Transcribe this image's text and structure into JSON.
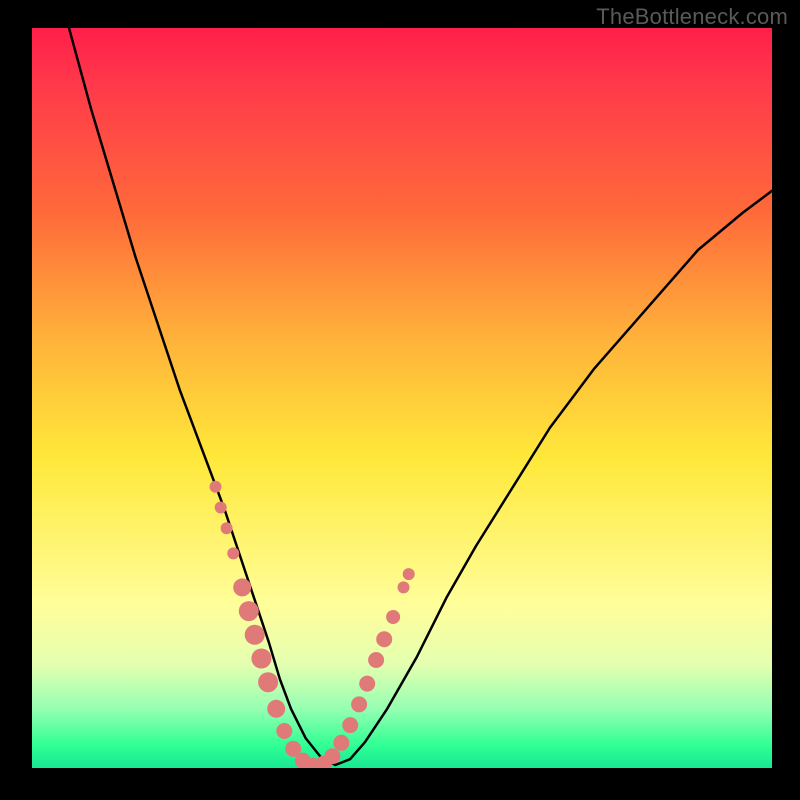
{
  "watermark": "TheBottleneck.com",
  "chart_data": {
    "type": "line",
    "title": "",
    "xlabel": "",
    "ylabel": "",
    "xlim": [
      0,
      100
    ],
    "ylim": [
      0,
      100
    ],
    "gradient_stops": [
      {
        "pos": 0,
        "color": "#ff1f4a"
      },
      {
        "pos": 8,
        "color": "#ff3a4a"
      },
      {
        "pos": 25,
        "color": "#ff6a3a"
      },
      {
        "pos": 42,
        "color": "#ffb23a"
      },
      {
        "pos": 58,
        "color": "#ffe83a"
      },
      {
        "pos": 78,
        "color": "#fffe9a"
      },
      {
        "pos": 86,
        "color": "#e4ffb0"
      },
      {
        "pos": 92,
        "color": "#95ffb2"
      },
      {
        "pos": 97,
        "color": "#2fff93"
      },
      {
        "pos": 100,
        "color": "#18e893"
      }
    ],
    "series": [
      {
        "name": "bottleneck-curve",
        "x": [
          5,
          8,
          11,
          14,
          17,
          20,
          23,
          26,
          28,
          30,
          32,
          33.5,
          35,
          37,
          39,
          41,
          43,
          45,
          48,
          52,
          56,
          60,
          65,
          70,
          76,
          83,
          90,
          96,
          100
        ],
        "y": [
          100,
          89,
          79,
          69,
          60,
          51,
          43,
          35,
          29,
          23,
          17,
          12,
          8,
          4,
          1.5,
          0.4,
          1.2,
          3.5,
          8,
          15,
          23,
          30,
          38,
          46,
          54,
          62,
          70,
          75,
          78
        ]
      }
    ],
    "points": {
      "name": "highlight-dots",
      "color": "#e07a78",
      "x": [
        24.8,
        25.5,
        26.3,
        27.2,
        28.4,
        29.3,
        30.1,
        31.0,
        31.9,
        33.0,
        34.1,
        35.3,
        36.6,
        38.0,
        39.4,
        40.6,
        41.8,
        43.0,
        44.2,
        45.3,
        46.5,
        47.6,
        48.8,
        50.2,
        50.9
      ],
      "y": [
        38.0,
        35.2,
        32.4,
        29.0,
        24.4,
        21.2,
        18.0,
        14.8,
        11.6,
        8.0,
        5.0,
        2.6,
        1.0,
        0.3,
        0.6,
        1.6,
        3.4,
        5.8,
        8.6,
        11.4,
        14.6,
        17.4,
        20.4,
        24.4,
        26.2
      ],
      "r": [
        6,
        6,
        6,
        6,
        9,
        10,
        10,
        10,
        10,
        9,
        8,
        8,
        8,
        8,
        8,
        8,
        8,
        8,
        8,
        8,
        8,
        8,
        7,
        6,
        6
      ]
    }
  }
}
